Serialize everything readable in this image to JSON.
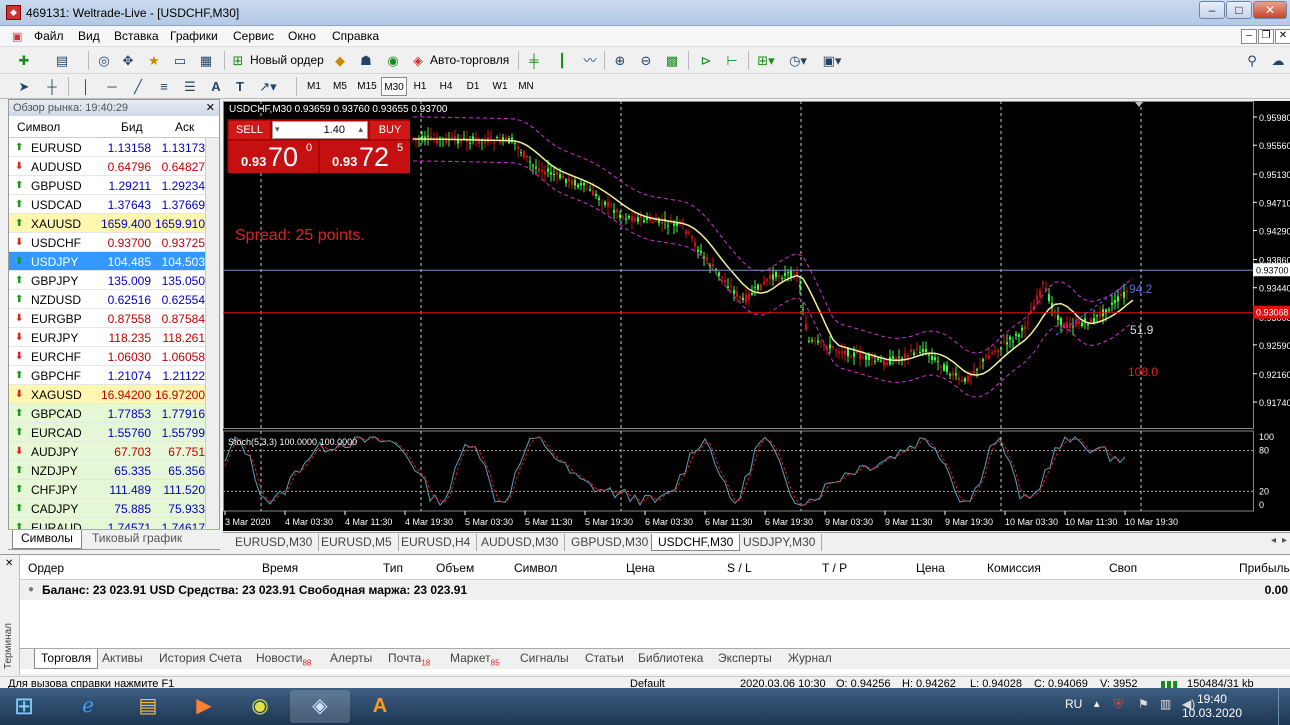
{
  "window": {
    "title": "469131: Weltrade-Live - [USDCHF,M30]"
  },
  "menu": [
    "Файл",
    "Вид",
    "Вставка",
    "Графики",
    "Сервис",
    "Окно",
    "Справка"
  ],
  "toolbar": {
    "new_order": "Новый ордер",
    "auto_trading": "Авто-торговля",
    "timeframes": [
      "M1",
      "M5",
      "M15",
      "M30",
      "H1",
      "H4",
      "D1",
      "W1",
      "MN"
    ],
    "active_timeframe": "M30"
  },
  "market_watch": {
    "header": "Обзор рынка: 19:40:29",
    "col_symbol": "Символ",
    "col_bid": "Бид",
    "col_ask": "Аск",
    "rows": [
      {
        "symbol": "EURUSD",
        "bid": "1.13158",
        "ask": "1.13173",
        "dir": "up"
      },
      {
        "symbol": "AUDUSD",
        "bid": "0.64796",
        "ask": "0.64827",
        "dir": "dn"
      },
      {
        "symbol": "GBPUSD",
        "bid": "1.29211",
        "ask": "1.29234",
        "dir": "up"
      },
      {
        "symbol": "USDCAD",
        "bid": "1.37643",
        "ask": "1.37669",
        "dir": "up"
      },
      {
        "symbol": "XAUUSD",
        "bid": "1659.400",
        "ask": "1659.910",
        "dir": "up",
        "bg": "#fff6b0"
      },
      {
        "symbol": "USDCHF",
        "bid": "0.93700",
        "ask": "0.93725",
        "dir": "dn"
      },
      {
        "symbol": "USDJPY",
        "bid": "104.485",
        "ask": "104.503",
        "dir": "up",
        "sel": true
      },
      {
        "symbol": "GBPJPY",
        "bid": "135.009",
        "ask": "135.050",
        "dir": "up"
      },
      {
        "symbol": "NZDUSD",
        "bid": "0.62516",
        "ask": "0.62554",
        "dir": "up"
      },
      {
        "symbol": "EURGBP",
        "bid": "0.87558",
        "ask": "0.87584",
        "dir": "dn"
      },
      {
        "symbol": "EURJPY",
        "bid": "118.235",
        "ask": "118.261",
        "dir": "dn"
      },
      {
        "symbol": "EURCHF",
        "bid": "1.06030",
        "ask": "1.06058",
        "dir": "dn"
      },
      {
        "symbol": "GBPCHF",
        "bid": "1.21074",
        "ask": "1.21122",
        "dir": "up"
      },
      {
        "symbol": "XAGUSD",
        "bid": "16.94200",
        "ask": "16.97200",
        "dir": "dn",
        "bg": "#fff6b0"
      },
      {
        "symbol": "GBPCAD",
        "bid": "1.77853",
        "ask": "1.77916",
        "dir": "up",
        "bg": "#e6f7d6"
      },
      {
        "symbol": "EURCAD",
        "bid": "1.55760",
        "ask": "1.55799",
        "dir": "up",
        "bg": "#e6f7d6"
      },
      {
        "symbol": "AUDJPY",
        "bid": "67.703",
        "ask": "67.751",
        "dir": "dn",
        "bg": "#e6f7d6"
      },
      {
        "symbol": "NZDJPY",
        "bid": "65.335",
        "ask": "65.356",
        "dir": "up",
        "bg": "#e6f7d6"
      },
      {
        "symbol": "CHFJPY",
        "bid": "111.489",
        "ask": "111.520",
        "dir": "up",
        "bg": "#e6f7d6"
      },
      {
        "symbol": "CADJPY",
        "bid": "75.885",
        "ask": "75.933",
        "dir": "up",
        "bg": "#e6f7d6"
      },
      {
        "symbol": "EURAUD",
        "bid": "1.74571",
        "ask": "1.74617",
        "dir": "up",
        "bg": "#e6f7d6"
      }
    ],
    "tabs": [
      "Символы",
      "Тиковый график"
    ]
  },
  "chart": {
    "info": "USDCHF,M30  0.93659 0.93760 0.93655 0.93700",
    "sell_label": "SELL",
    "buy_label": "BUY",
    "volume": "1.40",
    "sell_price_small": "0.93",
    "sell_price_big": "70",
    "sell_price_sup": "0",
    "buy_price_small": "0.93",
    "buy_price_big": "72",
    "buy_price_sup": "5",
    "spread": "Spread: 25 points.",
    "ann1": "94.2",
    "ann2": "51.9",
    "ann3": "108.0",
    "stoch_label": "Stoch(5,3,3) 100.0000 100.0000",
    "price_labels": [
      "0.95980",
      "0.95560",
      "0.95130",
      "0.94710",
      "0.94290",
      "0.93860",
      "0.93440",
      "0.93008",
      "0.92590",
      "0.92160",
      "0.91740"
    ],
    "current_ask": "0.93700",
    "current_bid": "0.93068",
    "stoch_axis": [
      "100",
      "80",
      "20",
      "0"
    ],
    "time_labels": [
      "3 Mar 2020",
      "4 Mar 03:30",
      "4 Mar 11:30",
      "4 Mar 19:30",
      "5 Mar 03:30",
      "5 Mar 11:30",
      "5 Mar 19:30",
      "6 Mar 03:30",
      "6 Mar 11:30",
      "6 Mar 19:30",
      "9 Mar 03:30",
      "9 Mar 11:30",
      "9 Mar 19:30",
      "10 Mar 03:30",
      "10 Mar 11:30",
      "10 Mar 19:30"
    ],
    "tabs": [
      "EURUSD,M30",
      "EURUSD,M5",
      "EURUSD,H4",
      "AUDUSD,M30",
      "GBPUSD,M30",
      "USDCHF,M30",
      "USDJPY,M30"
    ],
    "active_tab": "USDCHF,M30"
  },
  "terminal": {
    "side_label": "Терминал",
    "columns": [
      "Ордер",
      "Время",
      "Тип",
      "Объем",
      "Символ",
      "Цена",
      "S / L",
      "T / P",
      "Цена",
      "Комиссия",
      "Своп",
      "Прибыль"
    ],
    "balance": "Баланс: 23 023.91 USD  Средства: 23 023.91  Свободная маржа: 23 023.91",
    "balance_profit": "0.00",
    "tabs": [
      {
        "label": "Торговля",
        "badge": ""
      },
      {
        "label": "Активы",
        "badge": ""
      },
      {
        "label": "История Счета",
        "badge": ""
      },
      {
        "label": "Новости",
        "badge": "88"
      },
      {
        "label": "Алерты",
        "badge": ""
      },
      {
        "label": "Почта",
        "badge": "18"
      },
      {
        "label": "Маркет",
        "badge": "85"
      },
      {
        "label": "Сигналы",
        "badge": ""
      },
      {
        "label": "Статьи",
        "badge": ""
      },
      {
        "label": "Библиотека",
        "badge": ""
      },
      {
        "label": "Эксперты",
        "badge": ""
      },
      {
        "label": "Журнал",
        "badge": ""
      }
    ]
  },
  "status": {
    "help": "Для вызова справки нажмите F1",
    "profile": "Default",
    "datetime": "2020.03.06 10:30",
    "open": "O: 0.94256",
    "high": "H: 0.94262",
    "low": "L: 0.94028",
    "close": "C: 0.94069",
    "volume": "V: 3952",
    "traffic": "150484/31 kb"
  },
  "taskbar": {
    "lang": "RU",
    "time": "19:40",
    "date": "10.03.2020"
  },
  "colors": {
    "bull": "#3cff3c",
    "bear": "#d01010",
    "ma": "#f0f0a0",
    "band": "#d030d0",
    "bidline": "#e01010",
    "askline": "#8090c0"
  }
}
